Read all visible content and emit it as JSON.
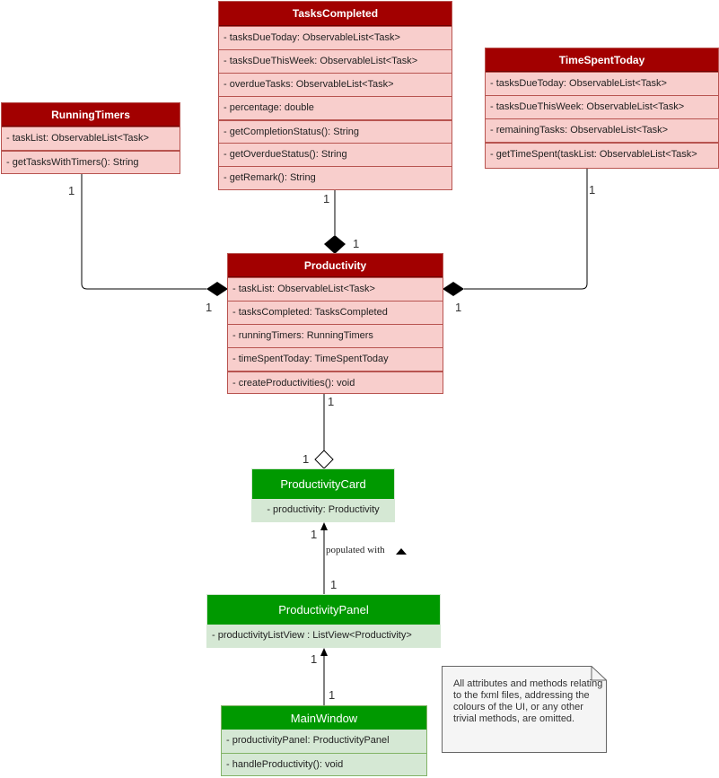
{
  "classes": {
    "tasks_completed": {
      "name": "TasksCompleted",
      "attributes": [
        "- tasksDueToday: ObservableList<Task>",
        "- tasksDueThisWeek: ObservableList<Task>",
        "- overdueTasks: ObservableList<Task>",
        "- percentage: double"
      ],
      "methods": [
        "- getCompletionStatus(): String",
        "- getOverdueStatus(): String",
        "- getRemark(): String"
      ]
    },
    "running_timers": {
      "name": "RunningTimers",
      "attributes": [
        "- taskList: ObservableList<Task>"
      ],
      "methods": [
        "- getTasksWithTimers(): String"
      ]
    },
    "time_spent_today": {
      "name": "TimeSpentToday",
      "attributes": [
        "- tasksDueToday: ObservableList<Task>",
        "- tasksDueThisWeek: ObservableList<Task>",
        "- remainingTasks: ObservableList<Task>"
      ],
      "methods": [
        "- getTimeSpent(taskList: ObservableList<Task>"
      ]
    },
    "productivity": {
      "name": "Productivity",
      "attributes": [
        "- taskList: ObservableList<Task>",
        "- tasksCompleted: TasksCompleted",
        "- runningTimers: RunningTimers",
        "- timeSpentToday: TimeSpentToday"
      ],
      "methods": [
        "- createProductivities(): void"
      ]
    },
    "productivity_card": {
      "name": "ProductivityCard",
      "attributes": [
        "- productivity: Productivity"
      ]
    },
    "productivity_panel": {
      "name": "ProductivityPanel",
      "attributes": [
        "- productivityListView : ListView<Productivity>"
      ]
    },
    "main_window": {
      "name": "MainWindow",
      "attributes": [
        "- productivityPanel: ProductivityPanel"
      ],
      "methods": [
        "- handleProductivity(): void"
      ]
    }
  },
  "relations": {
    "multiplicity": "1",
    "card_panel_label": "populated with"
  },
  "note": {
    "text": "All attributes and methods relating to the fxml files, addressing the colours of the UI, or any other trivial methods, are omitted."
  },
  "colors": {
    "red_header": "#a20000",
    "red_body": "#f8cecc",
    "red_border": "#b85450",
    "green_header": "#009900",
    "green_body": "#d5e8d4",
    "green_border": "#82b366",
    "note_fill": "#f5f5f5",
    "note_border": "#666666"
  }
}
